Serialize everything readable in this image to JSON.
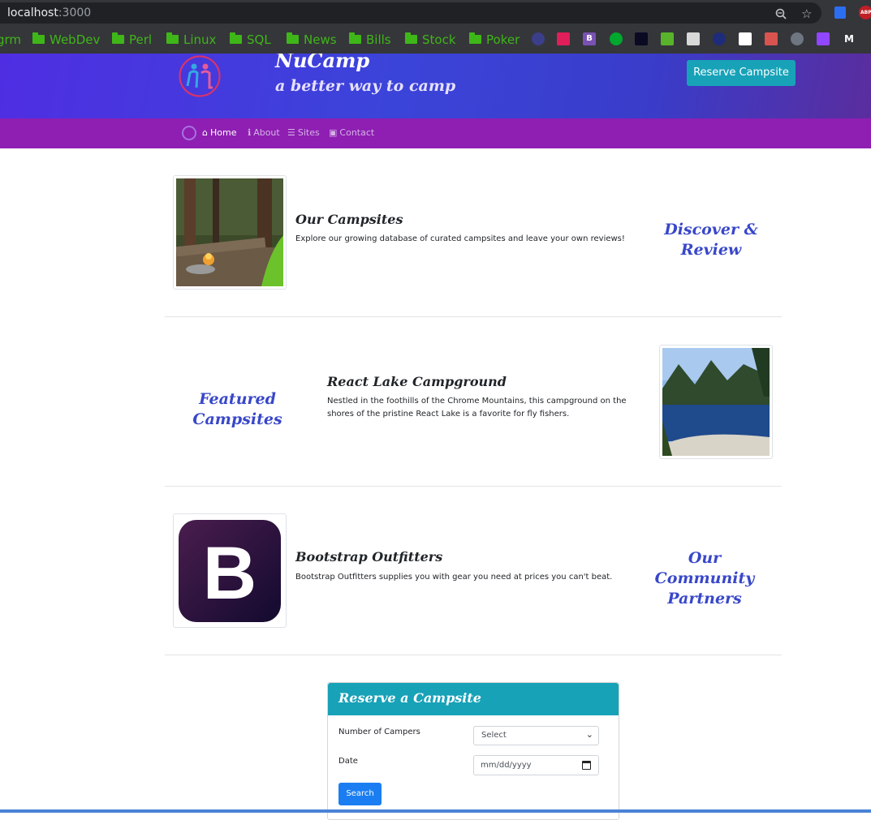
{
  "browser": {
    "url_host": "localhost",
    "url_port": ":3000",
    "bookmarks": [
      "grm",
      "WebDev",
      "Perl",
      "Linux",
      "SQL",
      "News",
      "Bills",
      "Stock",
      "Poker"
    ],
    "ext_abp": "ABP",
    "icon_bootstrap": "B",
    "icon_medium": "M"
  },
  "header": {
    "brand": "NuCamp",
    "tagline": "a better way to camp",
    "reserve_button": "Reserve Campsite"
  },
  "nav": {
    "items": [
      {
        "icon": "home-icon",
        "label": "Home",
        "active": true
      },
      {
        "icon": "info-icon",
        "label": "About"
      },
      {
        "icon": "list-icon",
        "label": "Sites"
      },
      {
        "icon": "address-card-icon",
        "label": "Contact"
      }
    ]
  },
  "sections": [
    {
      "title": "Our Campsites",
      "text": "Explore our growing database of curated campsites and leave your own reviews!",
      "side_heading": "Discover & Review"
    },
    {
      "title": "React Lake Campground",
      "text": "Nestled in the foothills of the Chrome Mountains, this campground on the shores of the pristine React Lake is a favorite for fly fishers.",
      "side_heading": "Featured Campsites"
    },
    {
      "title": "Bootstrap Outfitters",
      "text": "Bootstrap Outfitters supplies you with gear you need at prices you can't beat.",
      "side_heading": "Our Community Partners",
      "logo_letter": "B"
    }
  ],
  "reserve_form": {
    "title": "Reserve a Campsite",
    "campers_label": "Number of Campers",
    "campers_value": "Select",
    "date_label": "Date",
    "date_placeholder": "mm/dd/yyyy",
    "search_button": "Search"
  }
}
